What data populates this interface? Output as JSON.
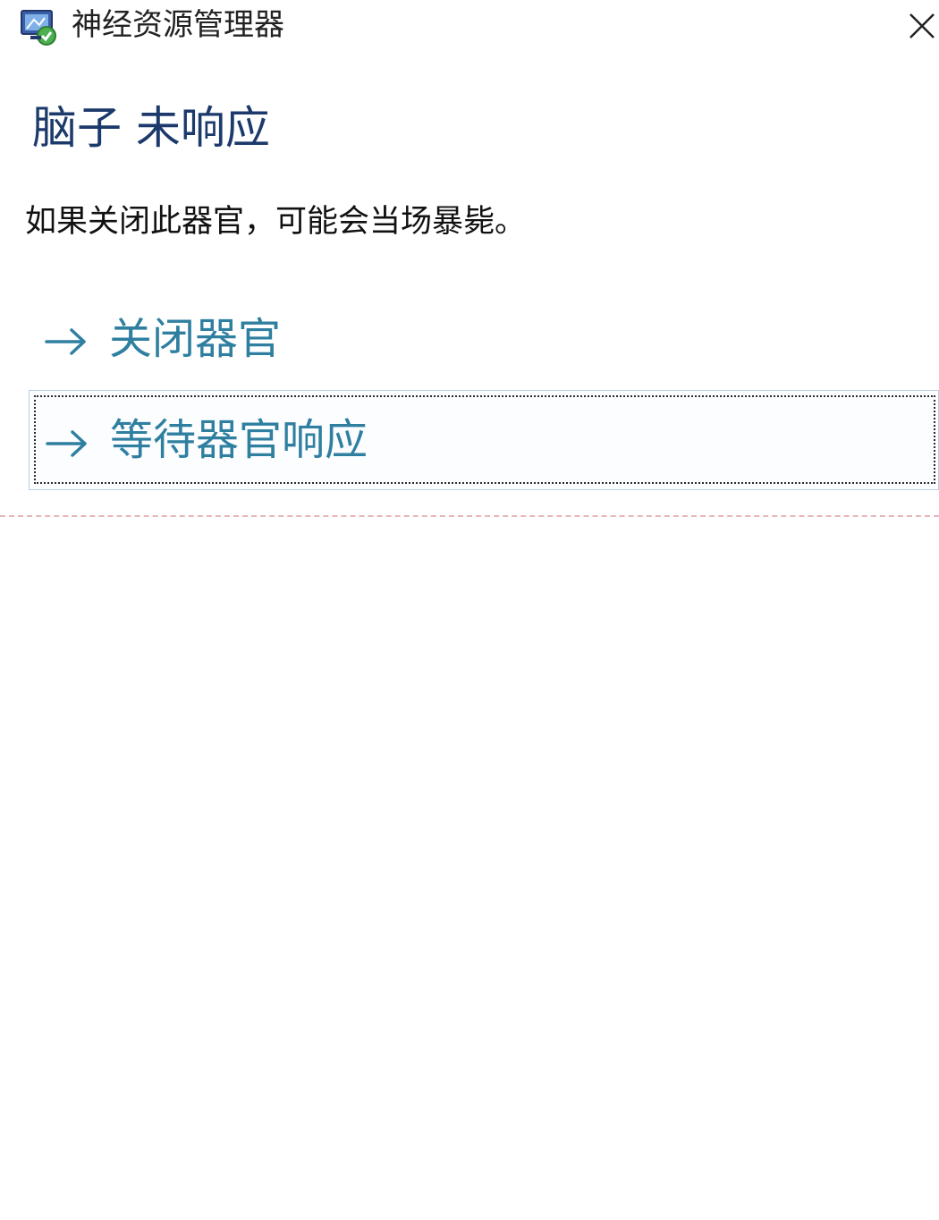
{
  "window": {
    "title": "神经资源管理器",
    "icon": "app-monitor-icon",
    "close_icon": "close-icon"
  },
  "dialog": {
    "heading": "脑子  未响应",
    "message": "如果关闭此器官，可能会当场暴毙。",
    "options": [
      {
        "label": "关闭器官",
        "icon": "arrow-right-icon"
      },
      {
        "label": "等待器官响应",
        "icon": "arrow-right-icon",
        "focused": true
      }
    ]
  },
  "colors": {
    "heading": "#1b3a6b",
    "option_text": "#2f7fa0",
    "option_arrow": "#2f7fa0",
    "focused_border": "#b9cfe6"
  }
}
